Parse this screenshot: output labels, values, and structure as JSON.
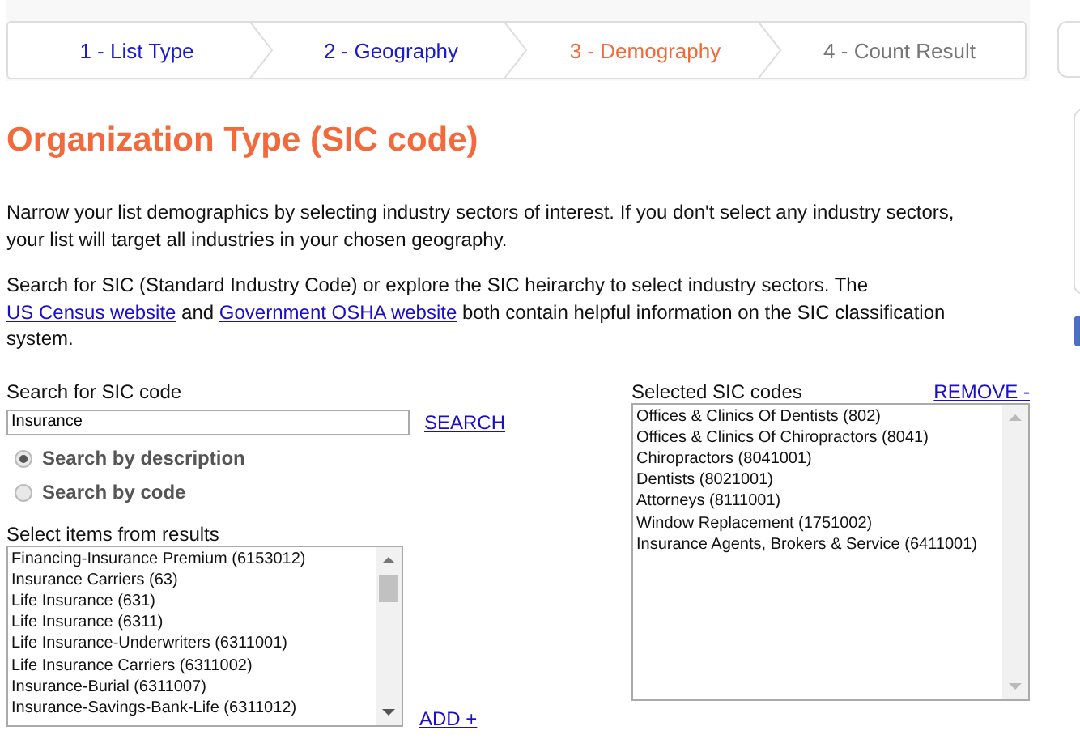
{
  "steps": [
    {
      "label": "1 - List Type",
      "selected": false,
      "disabled": false
    },
    {
      "label": "2 - Geography",
      "selected": false,
      "disabled": false
    },
    {
      "label": "3 - Demography",
      "selected": true,
      "disabled": false
    },
    {
      "label": "4 - Count Result",
      "selected": false,
      "disabled": true
    }
  ],
  "title": "Organization Type (SIC code)",
  "paragraphs": [
    {
      "text": "Narrow your list demographics by selecting industry sectors of interest. If you don't select any industry sectors, your list will target all industries in your chosen geography."
    },
    {
      "text": "Search for SIC (Standard Industry Code) or explore the SIC heirarchy to select industry sectors. The ",
      "links": [
        "US Census website",
        "Government OSHA website"
      ],
      "between": " and ",
      "after": " both contain helpful information on the SIC classification system."
    }
  ],
  "search": {
    "label": "Search for SIC code",
    "value": "Insurance",
    "button": "SEARCH"
  },
  "search_modes": [
    {
      "label": "Search by description",
      "selected": true
    },
    {
      "label": "Search by code",
      "selected": false
    }
  ],
  "results": {
    "label": "Select items from results",
    "items": [
      "Financing-Insurance Premium (6153012)",
      "Insurance Carriers (63)",
      "Life Insurance (631)",
      "Life Insurance (6311)",
      "Life Insurance-Underwriters (6311001)",
      "Life Insurance Carriers (6311002)",
      "Insurance-Burial (6311007)",
      "Insurance-Savings-Bank-Life (6311012)"
    ],
    "add": "ADD +"
  },
  "selected_codes": {
    "label": "Selected SIC codes",
    "remove": "REMOVE -",
    "items": [
      "Offices & Clinics Of Dentists (802)",
      "Offices & Clinics Of Chiropractors (8041)",
      "Chiropractors (8041001)",
      "Dentists (8021001)",
      "Attorneys (8111001)",
      "Window Replacement (1751002)",
      "Insurance Agents, Brokers & Service (6411001)"
    ]
  }
}
